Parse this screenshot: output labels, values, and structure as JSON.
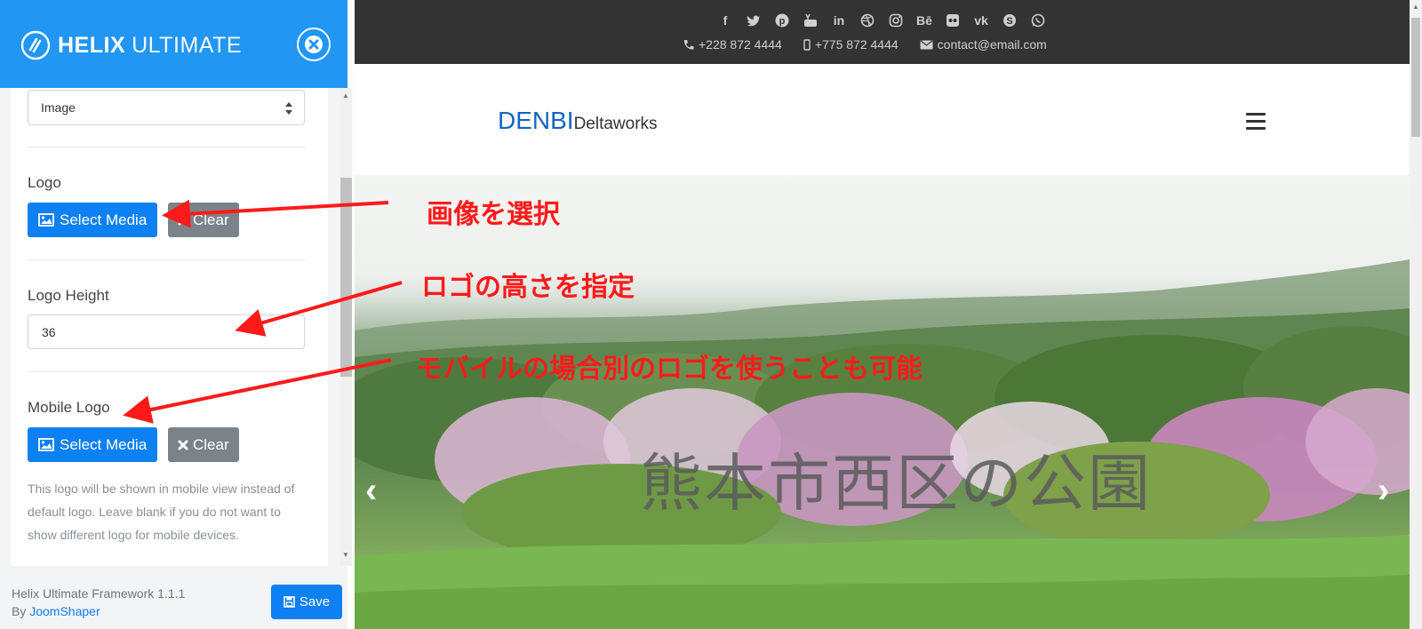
{
  "panel": {
    "brand_bold": "HELIX",
    "brand_light": "ULTIMATE",
    "logo_type_select": "Image",
    "logo_label": "Logo",
    "select_media_label": "Select Media",
    "clear_label": "Clear",
    "logo_height_label": "Logo Height",
    "logo_height_value": "36",
    "mobile_logo_label": "Mobile Logo",
    "mobile_select_media_label": "Select Media",
    "mobile_clear_label": "Clear",
    "mobile_help_text": "This logo will be shown in mobile view instead of default logo. Leave blank if you do not want to show different logo for mobile devices.",
    "footer_version": "Helix Ultimate Framework 1.1.1",
    "footer_by": "By",
    "footer_link": "JoomShaper",
    "save_label": "Save"
  },
  "preview": {
    "social_icons": [
      "facebook-icon",
      "twitter-icon",
      "pinterest-icon",
      "youtube-icon",
      "linkedin-icon",
      "dribbble-icon",
      "instagram-icon",
      "behance-icon",
      "flickr-icon",
      "vk-icon",
      "skype-icon",
      "whatsapp-icon"
    ],
    "phone": "+228 872 4444",
    "mobile": "+775 872 4444",
    "email": "contact@email.com",
    "logo_main": "DENBI",
    "logo_sub": "Deltaworks",
    "hero_title": "熊本市西区の公園"
  },
  "annotations": {
    "select_image": "画像を選択",
    "logo_height": "ロゴの高さを指定",
    "mobile_logo": "モバイルの場合別のロゴを使うことも可能"
  },
  "colors": {
    "header_blue": "#2196f3",
    "button_blue": "#0d80f2",
    "topbar_dark": "#333333",
    "annotation_red": "#ff1a1a"
  }
}
